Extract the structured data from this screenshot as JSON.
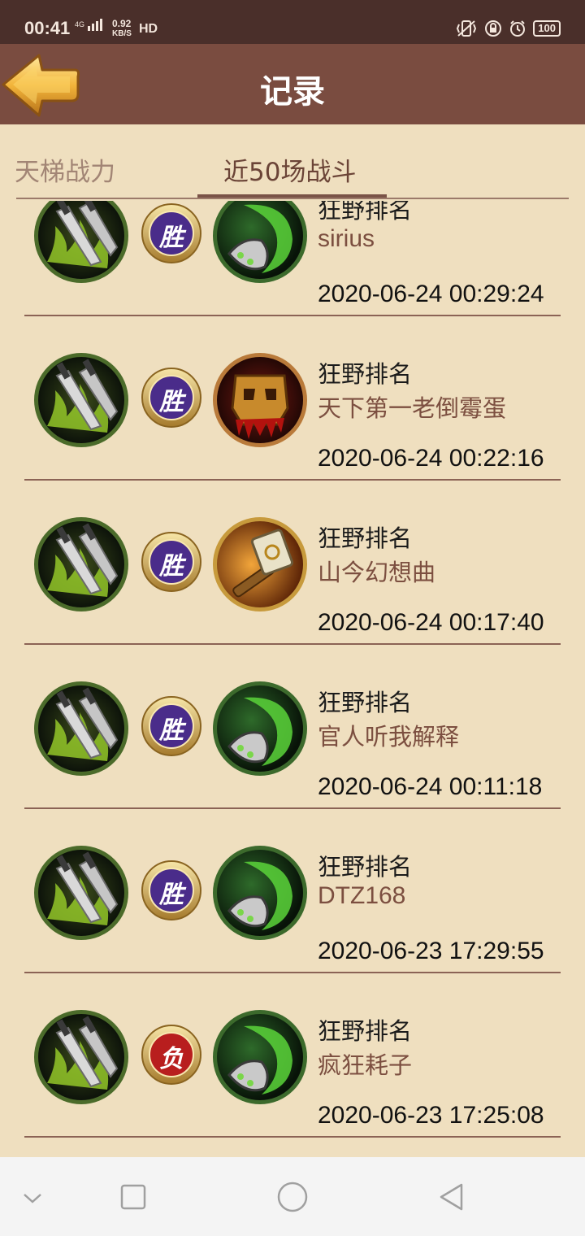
{
  "status_bar": {
    "time": "00:41",
    "network": "4G",
    "speed_value": "0.92",
    "speed_unit": "KB/S",
    "hd": "HD",
    "battery": "100"
  },
  "header": {
    "title": "记录",
    "back_icon": "back-arrow-icon"
  },
  "tabs": [
    {
      "label": "天梯战力",
      "selected": false
    },
    {
      "label": "近50场战斗",
      "selected": true
    }
  ],
  "battles": [
    {
      "mode": "狂野排名",
      "opponent": "sirius",
      "datetime": "2020-06-24 00:29:24",
      "result": "胜",
      "opponent_icon": "green-blade"
    },
    {
      "mode": "狂野排名",
      "opponent": "天下第一老倒霉蛋",
      "datetime": "2020-06-24 00:22:16",
      "result": "胜",
      "opponent_icon": "bloody-skull"
    },
    {
      "mode": "狂野排名",
      "opponent": "山今幻想曲",
      "datetime": "2020-06-24 00:17:40",
      "result": "胜",
      "opponent_icon": "golden-hammer"
    },
    {
      "mode": "狂野排名",
      "opponent": "官人听我解释",
      "datetime": "2020-06-24 00:11:18",
      "result": "胜",
      "opponent_icon": "green-blade"
    },
    {
      "mode": "狂野排名",
      "opponent": "DTZ168",
      "datetime": "2020-06-23 17:29:55",
      "result": "胜",
      "opponent_icon": "green-blade"
    },
    {
      "mode": "狂野排名",
      "opponent": "疯狂耗子",
      "datetime": "2020-06-23 17:25:08",
      "result": "负",
      "opponent_icon": "green-blade"
    }
  ],
  "colors": {
    "header_bg": "#7a4c40",
    "page_bg": "#efdfbf",
    "win_badge": "#4a2c8a",
    "loss_badge": "#b81e1e",
    "name_color": "#7c4f40"
  }
}
